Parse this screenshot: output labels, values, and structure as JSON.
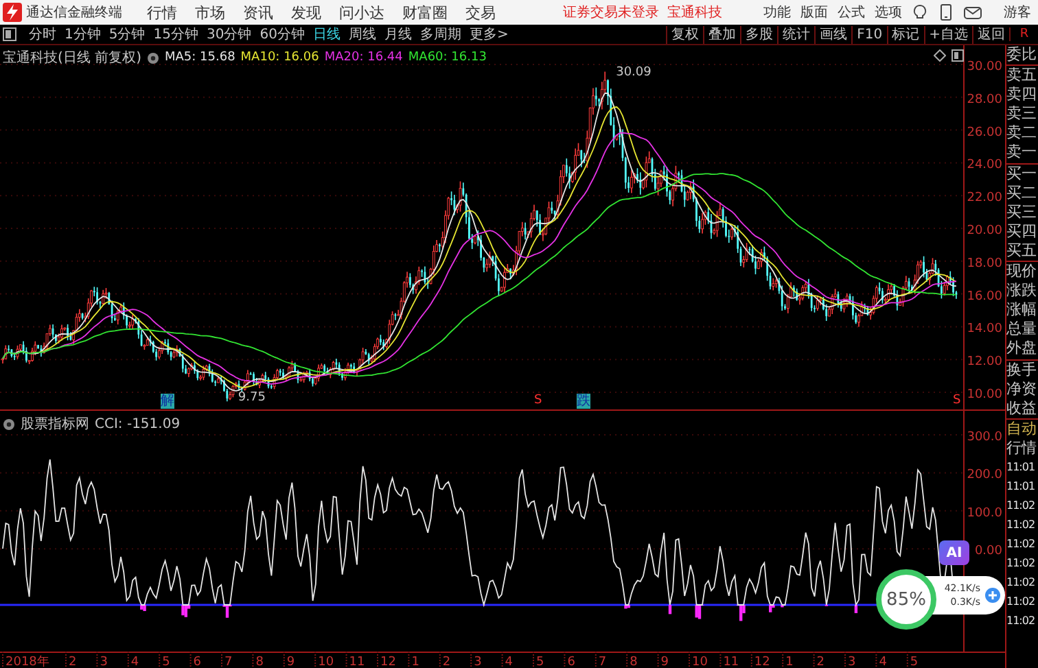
{
  "menu_bar": {
    "app_title": "通达信金融终端",
    "menus": [
      "行情",
      "市场",
      "资讯",
      "发现",
      "问小达",
      "财富圈",
      "交易"
    ],
    "notice": "证券交易未登录",
    "stock_link": "宝通科技",
    "tools": [
      "功能",
      "版面",
      "公式",
      "选项"
    ],
    "user": "游客"
  },
  "toolbar": {
    "periods": [
      {
        "label": "分时",
        "selected": false
      },
      {
        "label": "1分钟",
        "selected": false
      },
      {
        "label": "5分钟",
        "selected": false
      },
      {
        "label": "15分钟",
        "selected": false
      },
      {
        "label": "30分钟",
        "selected": false
      },
      {
        "label": "60分钟",
        "selected": false
      },
      {
        "label": "日线",
        "selected": true
      },
      {
        "label": "周线",
        "selected": false
      },
      {
        "label": "月线",
        "selected": false
      },
      {
        "label": "多周期",
        "selected": false
      },
      {
        "label": "更多>",
        "selected": false
      }
    ],
    "actions": [
      "复权",
      "叠加",
      "多股",
      "统计",
      "画线",
      "F10",
      "标记",
      "+自选",
      "返回"
    ],
    "corner": "R"
  },
  "price_panel": {
    "title": "宝通科技(日线 前复权)",
    "indicators": [
      {
        "label": "MA5: 15.68",
        "color": "#e6e6e6"
      },
      {
        "label": "MA10: 16.06",
        "color": "#e6e632"
      },
      {
        "label": "MA20: 16.44",
        "color": "#e632e6"
      },
      {
        "label": "MA60: 16.13",
        "color": "#32e632"
      }
    ],
    "high_label": "30.09",
    "low_label": "9.75",
    "axis_labels": [
      "30.00",
      "28.00",
      "26.00",
      "24.00",
      "22.00",
      "20.00",
      "18.00",
      "16.00",
      "14.00",
      "12.00",
      "10.00"
    ],
    "signals": [
      {
        "text": "解",
        "kind": "boxed"
      },
      {
        "text": "S",
        "kind": "mark"
      },
      {
        "text": "跌",
        "kind": "boxed"
      },
      {
        "text": "S",
        "kind": "mark"
      }
    ]
  },
  "indicator_panel": {
    "title": "股票指标网",
    "reading": "CCI: -151.09",
    "axis_labels": [
      "300.0",
      "200.0",
      "100.0",
      "0.00"
    ]
  },
  "date_axis": [
    "2018年",
    "2",
    "3",
    "4",
    "5",
    "6",
    "7",
    "8",
    "9",
    "10",
    "11",
    "12",
    "1",
    "2",
    "3",
    "4",
    "5",
    "6",
    "7",
    "8",
    "9",
    "10",
    "11",
    "12",
    "1",
    "2",
    "3",
    "4",
    "5"
  ],
  "quote_panel": {
    "groups": [
      [
        "委比"
      ],
      [
        "卖五",
        "卖四",
        "卖三",
        "卖二",
        "卖一"
      ],
      [
        "买一",
        "买二",
        "买三",
        "买四",
        "买五"
      ],
      [
        "现价",
        "涨跌",
        "涨幅",
        "总量",
        "外盘"
      ],
      [
        "换手",
        "净资",
        "收益"
      ]
    ],
    "mode": "自动",
    "section": "行情",
    "times": [
      "11:01",
      "11:01",
      "11:02",
      "11:02",
      "11:02",
      "11:02",
      "11:02",
      "11:02",
      "11:02"
    ]
  },
  "speed_widget": {
    "percent": "85%",
    "upload": "42.1K/s",
    "download": "0.3K/s",
    "ai_label": "AI"
  }
}
